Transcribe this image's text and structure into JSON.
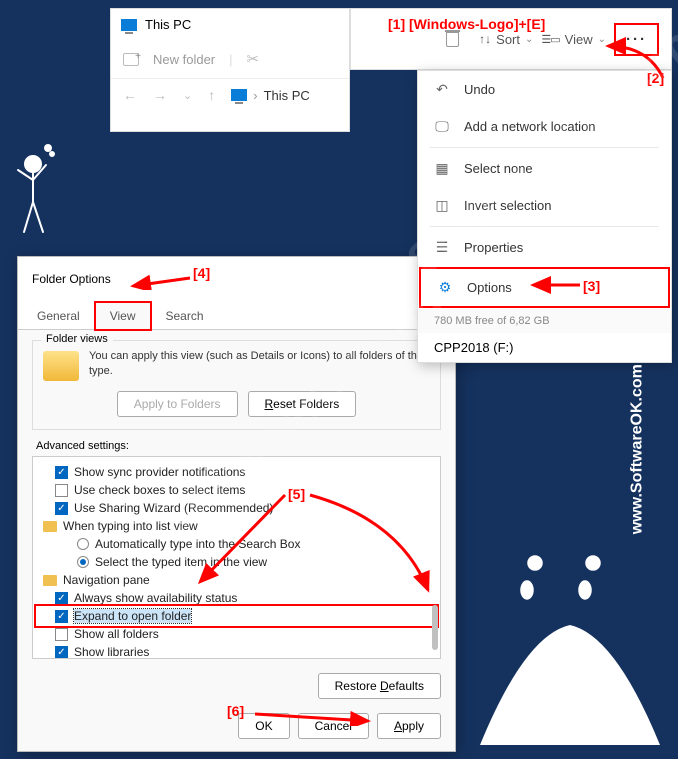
{
  "panel1": {
    "title": "This PC",
    "new_folder": "New folder",
    "breadcrumb": "This PC"
  },
  "panel2": {
    "sort": "Sort",
    "view": "View",
    "more": "···"
  },
  "menu": {
    "undo": "Undo",
    "add_net": "Add a network location",
    "sel_none": "Select none",
    "invert": "Invert selection",
    "properties": "Properties",
    "options": "Options"
  },
  "drive_info": {
    "free": "780 MB free of 6,82 GB",
    "name": "CPP2018 (F:)"
  },
  "dialog": {
    "title": "Folder Options",
    "tabs": {
      "general": "General",
      "view": "View",
      "search": "Search"
    },
    "folder_views": {
      "legend": "Folder views",
      "text": "You can apply this view (such as Details or Icons) to all folders of this type.",
      "apply": "Apply to Folders",
      "reset": "Reset Folders"
    },
    "adv_label": "Advanced settings:",
    "adv": {
      "sync": "Show sync provider notifications",
      "usecb": "Use check boxes to select items",
      "sharing": "Use Sharing Wizard (Recommended)",
      "typing": "When typing into list view",
      "auto_search": "Automatically type into the Search Box",
      "sel_typed": "Select the typed item in the view",
      "navpane": "Navigation pane",
      "avail": "Always show availability status",
      "expand": "Expand to open folder",
      "showall": "Show all folders",
      "showlib": "Show libraries"
    },
    "restore": "Restore Defaults",
    "ok": "OK",
    "cancel": "Cancel",
    "apply": "Apply"
  },
  "steps": {
    "s1": "[1]   [Windows-Logo]+[E]",
    "s2": "[2]",
    "s3": "[3]",
    "s4": "[4]",
    "s5": "[5]",
    "s6": "[6]"
  },
  "watermark": "SoftwareOK.com",
  "url": "www.SoftwareOK.com  :-)"
}
